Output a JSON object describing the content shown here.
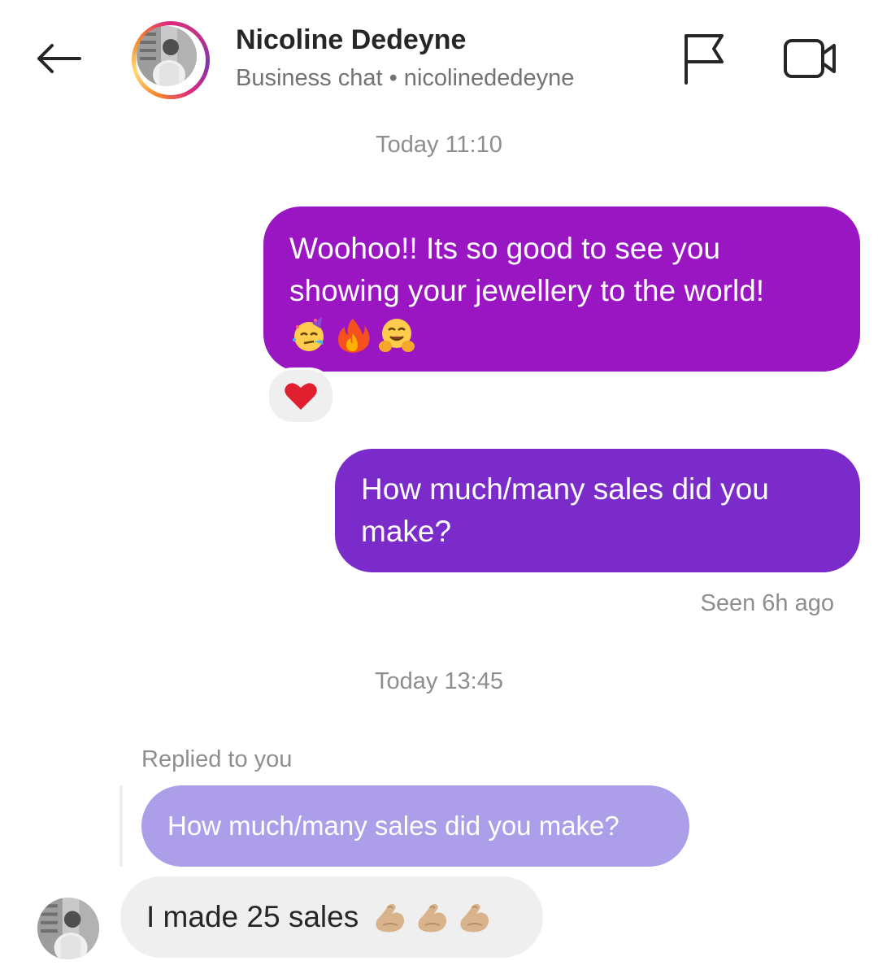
{
  "header": {
    "back_icon": "arrow-left-icon",
    "contact_name": "Nicoline Dedeyne",
    "subtitle": "Business chat • nicolinededeyne",
    "flag_icon": "flag-icon",
    "video_icon": "video-camera-icon"
  },
  "colors": {
    "outgoing_bubble_1": "#9a16c3",
    "outgoing_bubble_2": "#7a2bc9",
    "reply_quote_bubble": "#ac9ee8",
    "incoming_bubble": "#efefef"
  },
  "messages": {
    "timestamp_1": "Today 11:10",
    "outgoing_1": {
      "line_1": "Woohoo!! Its so good to see you",
      "line_2": "showing your jewellery to the world!",
      "emojis": [
        "partying-face-icon",
        "fire-icon",
        "hugging-face-icon"
      ],
      "reaction": "red-heart-icon"
    },
    "outgoing_2": {
      "line_1": "How much/many sales did you",
      "line_2": "make?"
    },
    "seen_status": "Seen 6h ago",
    "timestamp_2": "Today 13:45",
    "reply_label": "Replied to you",
    "quoted_text": "How much/many sales did you make?",
    "incoming_1": {
      "text": "I made 25 sales",
      "emojis": [
        "flexed-biceps-icon",
        "flexed-biceps-icon",
        "flexed-biceps-icon"
      ]
    }
  }
}
